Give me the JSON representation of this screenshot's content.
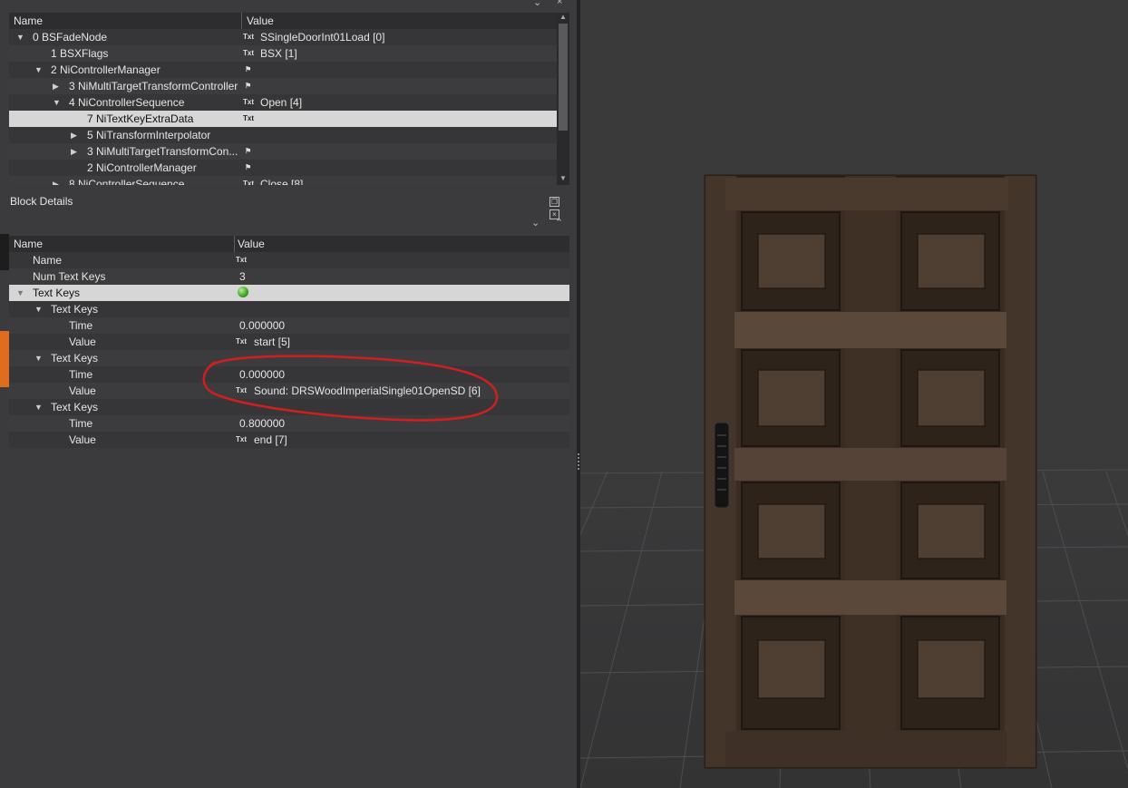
{
  "top": {
    "expand_icon": "chevron-down-icon",
    "close_icon": "close-icon"
  },
  "tree": {
    "columns": {
      "name": "Name",
      "value": "Value"
    },
    "rows": [
      {
        "label": "0 BSFadeNode",
        "value": "SSingleDoorInt01Load [0]",
        "icon": "Txt"
      },
      {
        "label": "1 BSXFlags",
        "value": "BSX [1]",
        "icon": "Txt"
      },
      {
        "label": "2 NiControllerManager",
        "value": "",
        "icon": "flag"
      },
      {
        "label": "3 NiMultiTargetTransformController",
        "value": "",
        "icon": "flag"
      },
      {
        "label": "4 NiControllerSequence",
        "value": "Open [4]",
        "icon": "Txt"
      },
      {
        "label": "7 NiTextKeyExtraData",
        "value": "",
        "icon": "Txt"
      },
      {
        "label": "5 NiTransformInterpolator",
        "value": "",
        "icon": ""
      },
      {
        "label": "3 NiMultiTargetTransformCon...",
        "value": "",
        "icon": "flag"
      },
      {
        "label": "2 NiControllerManager",
        "value": "",
        "icon": "flag"
      },
      {
        "label": "8 NiControllerSequence",
        "value": "Close [8]",
        "icon": "Txt"
      }
    ]
  },
  "block_details": {
    "title": "Block Details",
    "columns": {
      "name": "Name",
      "value": "Value"
    },
    "rows": [
      {
        "label": "Name",
        "value": "",
        "icon": "Txt"
      },
      {
        "label": "Num Text Keys",
        "value": "3",
        "icon": ""
      },
      {
        "label": "Text Keys",
        "value": "",
        "icon": "green"
      },
      {
        "label": "Text Keys",
        "value": "",
        "icon": ""
      },
      {
        "label": "Time",
        "value": "0.000000",
        "icon": ""
      },
      {
        "label": "Value",
        "value": "start [5]",
        "icon": "Txt"
      },
      {
        "label": "Text Keys",
        "value": "",
        "icon": ""
      },
      {
        "label": "Time",
        "value": "0.000000",
        "icon": ""
      },
      {
        "label": "Value",
        "value": "Sound: DRSWoodImperialSingle01OpenSD [6]",
        "icon": "Txt"
      },
      {
        "label": "Text Keys",
        "value": "",
        "icon": ""
      },
      {
        "label": "Time",
        "value": "0.800000",
        "icon": ""
      },
      {
        "label": "Value",
        "value": "end [7]",
        "icon": "Txt"
      }
    ]
  },
  "icon_text": "Txt",
  "colors": {
    "annotation": "#d11f1f",
    "selection": "#d6d6d6"
  }
}
